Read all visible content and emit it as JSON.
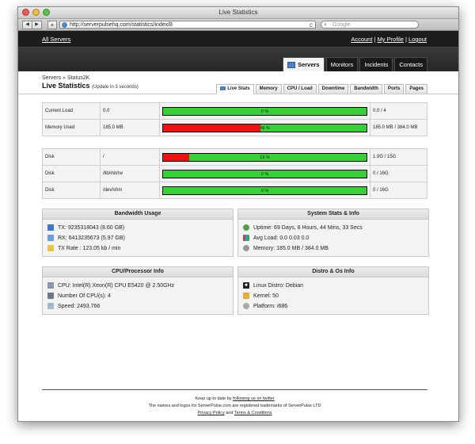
{
  "window": {
    "title": "Live Statistics"
  },
  "browser": {
    "back": "◀",
    "forward": "▶",
    "add_tab": "+",
    "url": "http://serverpulsehq.com/statistics/index/8",
    "reload": "c",
    "search_placeholder": "Google"
  },
  "header": {
    "all_servers": "All Servers",
    "account": "Account",
    "sep1": "|",
    "my_profile": "My Profile",
    "sep2": "|",
    "logout": "Logout"
  },
  "main_tabs": [
    "Servers",
    "Monitors",
    "Incidents",
    "Contacts"
  ],
  "breadcrumb": {
    "servers": "Servers",
    "sep": "»",
    "current": "Status2K"
  },
  "page": {
    "title": "Live Statistics",
    "update_note": "(Update in 3 seconds)"
  },
  "sub_tabs": [
    "Live Stats",
    "Memory",
    "CPU / Load",
    "Downtime",
    "Bandwidth",
    "Ports",
    "Pages"
  ],
  "load_rows": [
    {
      "name": "Current Load",
      "value": "0.0",
      "percent_label": "0 %",
      "percent": 0,
      "total": "0.0 / 4"
    },
    {
      "name": "Memory Used",
      "value": "185.0 MB",
      "percent_label": "48 %",
      "percent": 48,
      "total": "185.0 MB / 384.0 MB"
    }
  ],
  "disk_rows": [
    {
      "name": "Disk",
      "mount": "/",
      "percent_label": "13 %",
      "percent": 13,
      "total": "1.9G / 15G"
    },
    {
      "name": "Disk",
      "mount": "/lib/init/rw",
      "percent_label": "0 %",
      "percent": 0,
      "total": "0 / 16G"
    },
    {
      "name": "Disk",
      "mount": "/dev/shm",
      "percent_label": "0 %",
      "percent": 0,
      "total": "0 / 16G"
    }
  ],
  "bandwidth": {
    "title": "Bandwidth Usage",
    "tx": "TX: 9235318043 (8.60 GB)",
    "rx": "RX: 6413235673 (5.97 GB)",
    "rate": "TX Rate : 123.05 kb / min"
  },
  "system": {
    "title": "System Stats & Info",
    "uptime": "Uptime: 69 Days, 8 Hours, 44 Mins, 33 Secs",
    "avg_load": "Avg Load: 0.0 0.03 0.0",
    "memory": "Memory: 185.0 MB / 384.0 MB"
  },
  "cpu": {
    "title": "CPU/Processor Info",
    "model": "CPU: Intel(R) Xeon(R) CPU E5420 @ 2.50GHz",
    "count": "Number Of CPU(s): 4",
    "speed": "Speed: 2493.766"
  },
  "distro": {
    "title": "Distro & Os Info",
    "name": "Linux Distro: Debian",
    "kernel": "Kernel: 50",
    "platform": "Platform: i686"
  },
  "footer": {
    "line1_prefix": "Keep up to date by ",
    "line1_link": "following us on twitter",
    "line2": "The names and logos for ServerPulse.com are registered trademarks of ServerPulse LTD",
    "privacy": "Privacy Policy",
    "and": " and ",
    "terms": "Terms & Conditions"
  },
  "colors": {
    "bar_ok": "#35d135",
    "bar_used": "#ee1111",
    "header_bg": "#1c1c1c"
  },
  "icons": [
    "tx-icon",
    "rx-icon",
    "rate-icon",
    "uptime-icon",
    "avg-load-icon",
    "memory-icon",
    "cpu-icon",
    "cpu-count-icon",
    "speed-icon",
    "linux-icon",
    "kernel-icon",
    "platform-icon"
  ]
}
